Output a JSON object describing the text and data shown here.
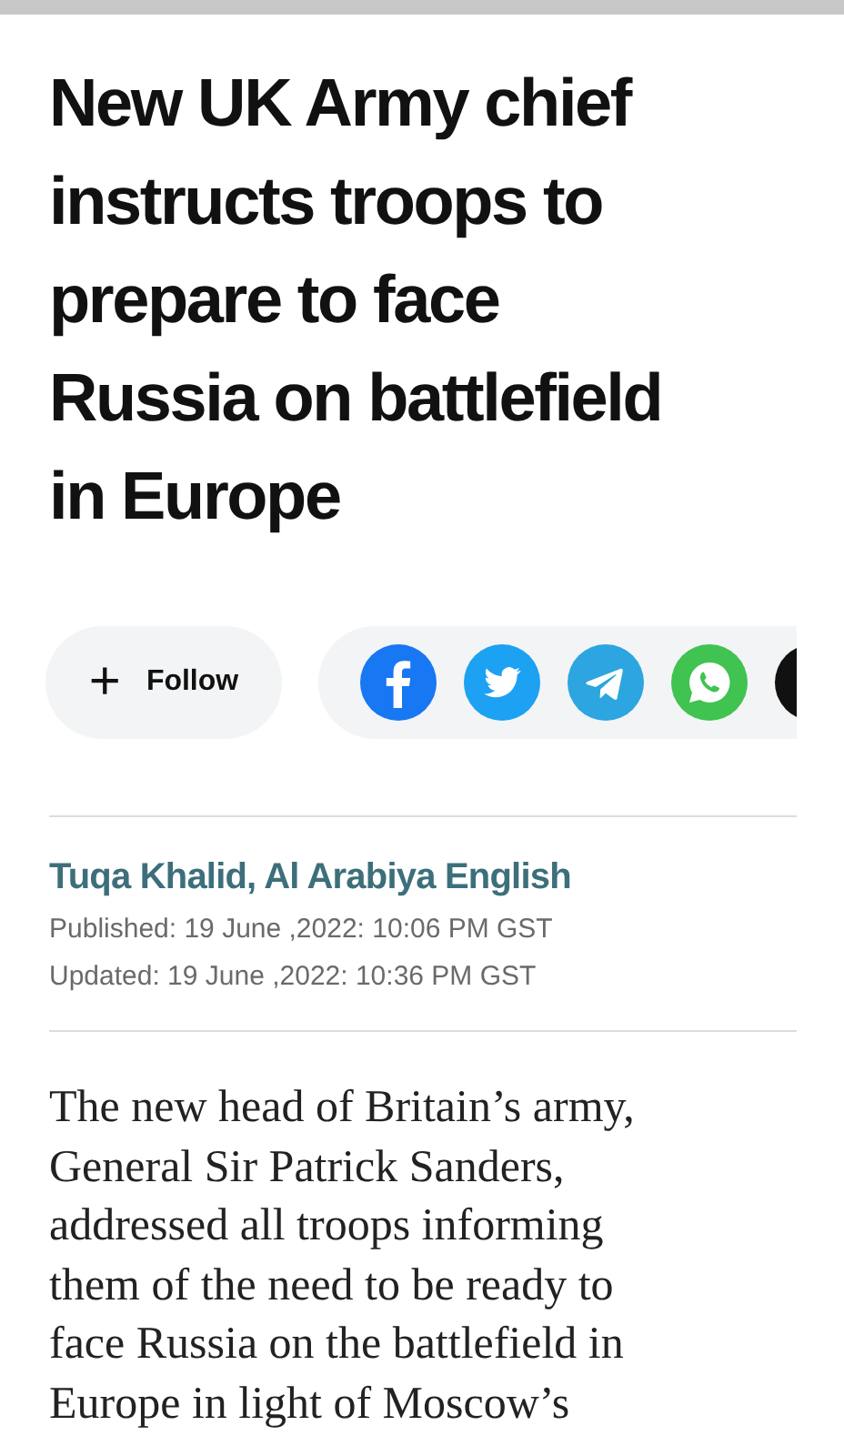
{
  "headline_lines": [
    "New UK Army chief",
    "instructs troops to",
    "prepare to face",
    "Russia on battlefield",
    "in Europe"
  ],
  "follow_button": {
    "icon": "+",
    "label": "Follow"
  },
  "share_buttons": [
    {
      "kind": "facebook",
      "color": "#1877f2"
    },
    {
      "kind": "twitter",
      "color": "#1da1f2"
    },
    {
      "kind": "telegram",
      "color": "#2ca5e0"
    },
    {
      "kind": "whatsapp",
      "color": "#40c351"
    },
    {
      "kind": "more",
      "color": "#111111"
    }
  ],
  "author": "Tuqa Khalid, Al Arabiya English",
  "published": "Published: 19 June ,2022: 10:06 PM GST",
  "updated": "Updated: 19 June ,2022: 10:36 PM GST",
  "body_lines": [
    "The new head of Britain’s army,",
    "General Sir Patrick Sanders,",
    "addressed all troops informing",
    "them of the need to be ready to",
    "face Russia on the battlefield in",
    "Europe in light of Moscow’s"
  ]
}
